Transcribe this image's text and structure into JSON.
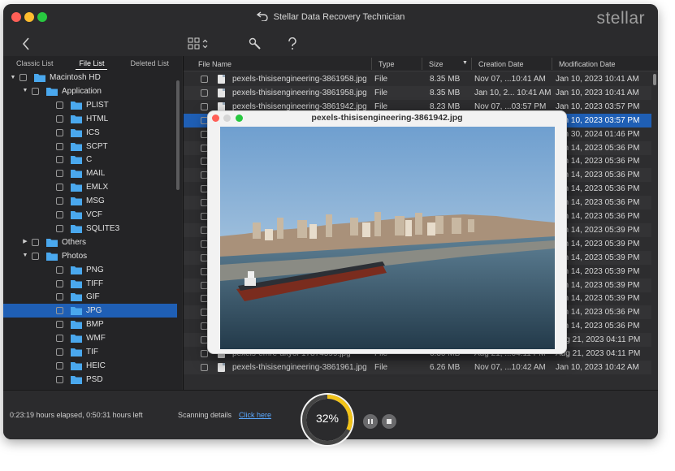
{
  "window": {
    "title": "Stellar Data Recovery Technician",
    "brand": "stellar"
  },
  "tabs": [
    "Classic List",
    "File List",
    "Deleted List"
  ],
  "active_tab": "File List",
  "tree": [
    {
      "label": "Macintosh HD",
      "level": 0,
      "expanded": true
    },
    {
      "label": "Application",
      "level": 1,
      "expanded": true
    },
    {
      "label": "PLIST",
      "level": 2
    },
    {
      "label": "HTML",
      "level": 2
    },
    {
      "label": "ICS",
      "level": 2
    },
    {
      "label": "SCPT",
      "level": 2
    },
    {
      "label": "C",
      "level": 2
    },
    {
      "label": "MAIL",
      "level": 2
    },
    {
      "label": "EMLX",
      "level": 2
    },
    {
      "label": "MSG",
      "level": 2
    },
    {
      "label": "VCF",
      "level": 2
    },
    {
      "label": "SQLITE3",
      "level": 2
    },
    {
      "label": "Others",
      "level": 1,
      "expanded": false
    },
    {
      "label": "Photos",
      "level": 1,
      "expanded": true
    },
    {
      "label": "PNG",
      "level": 2
    },
    {
      "label": "TIFF",
      "level": 2
    },
    {
      "label": "GIF",
      "level": 2
    },
    {
      "label": "JPG",
      "level": 2,
      "selected": true
    },
    {
      "label": "BMP",
      "level": 2
    },
    {
      "label": "WMF",
      "level": 2
    },
    {
      "label": "TIF",
      "level": 2
    },
    {
      "label": "HEIC",
      "level": 2
    },
    {
      "label": "PSD",
      "level": 2
    }
  ],
  "columns": [
    "File Name",
    "Type",
    "Size",
    "Creation Date",
    "Modification Date"
  ],
  "rows": [
    {
      "name": "pexels-thisisengineering-3861958.jpg",
      "type": "File",
      "size": "8.35 MB",
      "created": "Nov 07, ...10:41 AM",
      "modified": "Jan 10, 2023 10:41 AM"
    },
    {
      "name": "pexels-thisisengineering-3861958.jpg",
      "type": "File",
      "size": "8.35 MB",
      "created": "Jan 10, 2... 10:41 AM",
      "modified": "Jan 10, 2023 10:41 AM"
    },
    {
      "name": "pexels-thisisengineering-3861942.jpg",
      "type": "File",
      "size": "8.23 MB",
      "created": "Nov 07, ...03:57 PM",
      "modified": "Jan 10, 2023 03:57 PM"
    },
    {
      "name": "",
      "type": "",
      "size": "",
      "created": "",
      "modified": "Jan 10, 2023 03:57 PM",
      "selected": true
    },
    {
      "name": "",
      "type": "",
      "size": "",
      "created": "",
      "modified": "Jan 30, 2024 01:46 PM"
    },
    {
      "name": "",
      "type": "",
      "size": "",
      "created": "",
      "modified": "Jan 14, 2023 05:36 PM"
    },
    {
      "name": "",
      "type": "",
      "size": "",
      "created": "",
      "modified": "Jan 14, 2023 05:36 PM"
    },
    {
      "name": "",
      "type": "",
      "size": "",
      "created": "",
      "modified": "Jan 14, 2023 05:36 PM"
    },
    {
      "name": "",
      "type": "",
      "size": "",
      "created": "",
      "modified": "Jan 14, 2023 05:36 PM"
    },
    {
      "name": "",
      "type": "",
      "size": "",
      "created": "",
      "modified": "Jan 14, 2023 05:36 PM"
    },
    {
      "name": "",
      "type": "",
      "size": "",
      "created": "",
      "modified": "Jan 14, 2023 05:36 PM"
    },
    {
      "name": "",
      "type": "",
      "size": "",
      "created": "",
      "modified": "Jan 14, 2023 05:39 PM"
    },
    {
      "name": "",
      "type": "",
      "size": "",
      "created": "",
      "modified": "Jan 14, 2023 05:39 PM"
    },
    {
      "name": "",
      "type": "",
      "size": "",
      "created": "",
      "modified": "Jan 14, 2023 05:39 PM"
    },
    {
      "name": "",
      "type": "",
      "size": "",
      "created": "",
      "modified": "Jan 14, 2023 05:39 PM"
    },
    {
      "name": "",
      "type": "",
      "size": "",
      "created": "",
      "modified": "Jan 14, 2023 05:39 PM"
    },
    {
      "name": "",
      "type": "",
      "size": "",
      "created": "",
      "modified": "Jan 14, 2023 05:39 PM"
    },
    {
      "name": "",
      "type": "",
      "size": "",
      "created": "",
      "modified": "Jan 14, 2023 05:36 PM"
    },
    {
      "name": "",
      "type": "",
      "size": "",
      "created": "",
      "modified": "Jan 14, 2023 05:36 PM"
    },
    {
      "name": "",
      "type": "",
      "size": "",
      "created": "",
      "modified": "Aug 21, 2023 04:11 PM"
    },
    {
      "name": "pexels-emre-akyol-17874599.jpg",
      "type": "File",
      "size": "6.30 MB",
      "created": "Aug 21, ...04:11 PM",
      "modified": "Aug 21, 2023 04:11 PM"
    },
    {
      "name": "pexels-thisisengineering-3861961.jpg",
      "type": "File",
      "size": "6.26 MB",
      "created": "Nov 07, ...10:42 AM",
      "modified": "Jan 10, 2023 10:42 AM"
    }
  ],
  "status": {
    "elapsed": "0:23:19 hours elapsed, 0:50:31 hours left",
    "scan_label": "Scanning details",
    "scan_link": "Click here",
    "progress_text": "32%",
    "progress_value": 0.32
  },
  "preview": {
    "title": "pexels-thisisengineering-3861942.jpg"
  },
  "colors": {
    "selection": "#1f5fb5",
    "progress": "#f2c318",
    "link": "#5aa8ff",
    "folder": "#4aa8ee"
  }
}
